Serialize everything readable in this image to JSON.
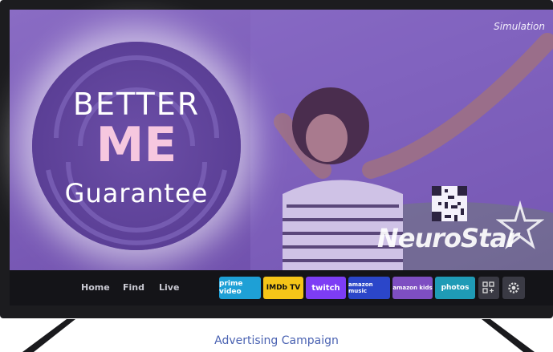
{
  "screen": {
    "simulation_label": "Simulation",
    "headline": {
      "line1": "BETTER",
      "line2": "ME",
      "line3": "Guarantee"
    },
    "brand": "NeuroStar"
  },
  "nav": {
    "home": "Home",
    "find": "Find",
    "live": "Live"
  },
  "apps": [
    {
      "label": "prime video",
      "color": "#1ea0d6"
    },
    {
      "label": "IMDb TV",
      "color": "#f5c518"
    },
    {
      "label": "twitch",
      "color": "#7d3df5"
    },
    {
      "label": "amazon music",
      "color": "#2b46c9"
    },
    {
      "label": "amazon kids",
      "color": "#7e4ec2"
    },
    {
      "label": "photos",
      "color": "#1f9bb6"
    }
  ],
  "caption": "Advertising Campaign"
}
